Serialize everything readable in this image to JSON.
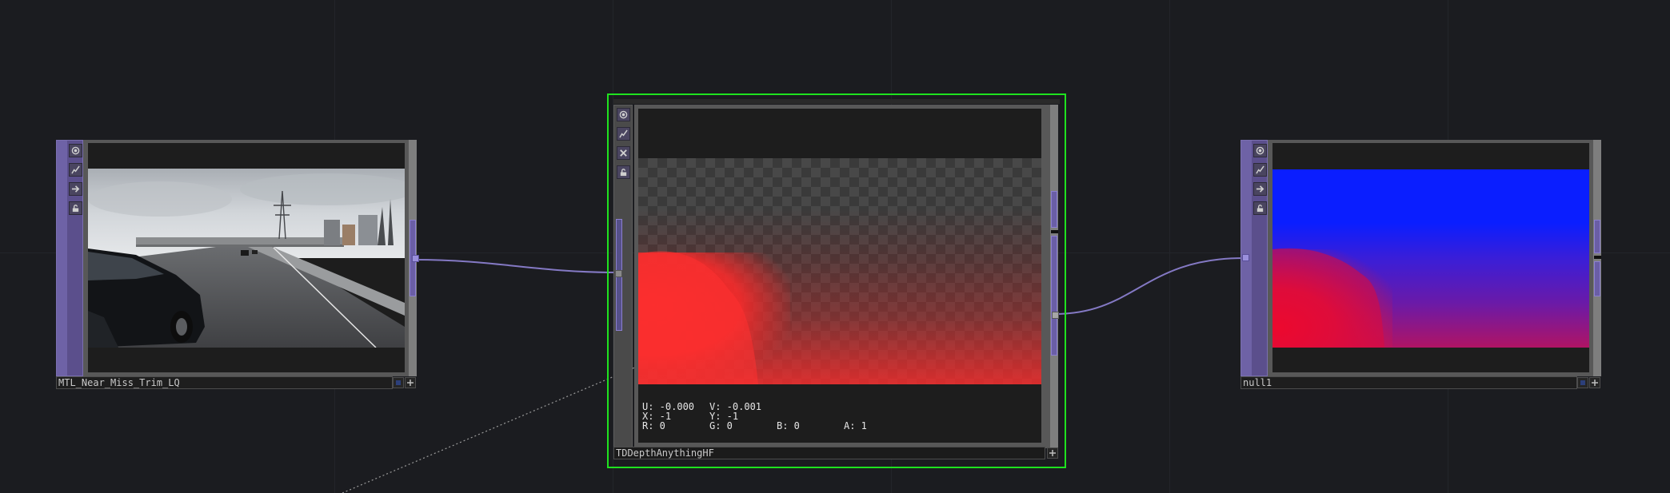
{
  "nodes": {
    "movie": {
      "label": "MTL_Near_Miss_Trim_LQ"
    },
    "depth": {
      "label": "TDDepthAnythingHF",
      "probe": {
        "u": "U: -0.000",
        "v": "V: -0.001",
        "x": "X: -1",
        "y": "Y: -1",
        "r": "R: 0",
        "g": "G: 0",
        "b": "B: 0",
        "a": "A: 1"
      }
    },
    "null": {
      "label": "null1"
    }
  },
  "colors": {
    "background": "#1b1c20",
    "wire": "#8479c4",
    "selection": "#1fe21f",
    "node_side": "#5b4f8c",
    "depth_near": "#ff2a2a",
    "null_far": "#0a1eff",
    "null_near": "#ff0a1e"
  },
  "icons": {
    "viewer_toggle": "viewer-circle-icon",
    "display_flag": "wave-flag-icon",
    "bypass_flag": "bypass-x-icon",
    "cook_flag": "arrow-right-icon",
    "lock_flag": "lock-icon",
    "add": "plus-icon"
  }
}
